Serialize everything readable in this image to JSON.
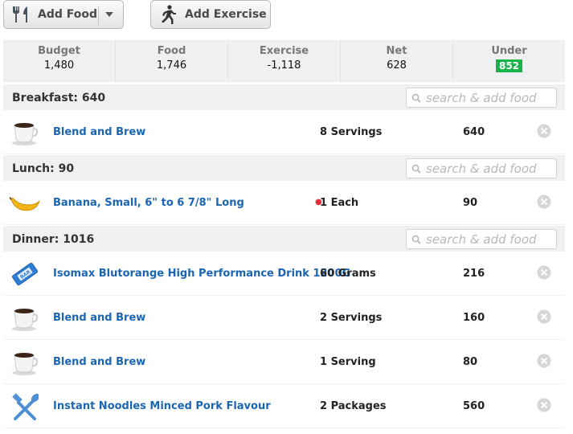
{
  "toolbar": {
    "add_food_label": "Add Food",
    "add_exercise_label": "Add Exercise"
  },
  "summary": {
    "budget_label": "Budget",
    "budget_value": "1,480",
    "food_label": "Food",
    "food_value": "1,746",
    "exercise_label": "Exercise",
    "exercise_value": "-1,118",
    "net_label": "Net",
    "net_value": "628",
    "under_label": "Under",
    "under_value": "852"
  },
  "search_placeholder": "search & add food",
  "meals": {
    "breakfast": {
      "title": "Breakfast: 640",
      "items": [
        {
          "name": "Blend and Brew",
          "qty": "8 Servings",
          "cal": "640",
          "icon": "coffee-cup-icon"
        }
      ]
    },
    "lunch": {
      "title": "Lunch: 90",
      "items": [
        {
          "name": "Banana, Small, 6\" to 6 7/8\" Long",
          "qty": "1 Each",
          "cal": "90",
          "icon": "banana-icon"
        }
      ]
    },
    "dinner": {
      "title": "Dinner: 1016",
      "items": [
        {
          "name": "Isomax Blutorange High Performance Drink 1200G",
          "qty": "60 Grams",
          "cal": "216",
          "icon": "bar-wrapper-icon"
        },
        {
          "name": "Blend and Brew",
          "qty": "2 Servings",
          "cal": "160",
          "icon": "coffee-cup-icon"
        },
        {
          "name": "Blend and Brew",
          "qty": "1 Serving",
          "cal": "80",
          "icon": "coffee-cup-icon"
        },
        {
          "name": "Instant Noodles Minced Pork Flavour",
          "qty": "2 Packages",
          "cal": "560",
          "icon": "fork-spoon-icon"
        }
      ]
    }
  },
  "colors": {
    "link": "#1a66b3",
    "under_badge": "#18b44a",
    "section_bg": "#eef0f2"
  }
}
